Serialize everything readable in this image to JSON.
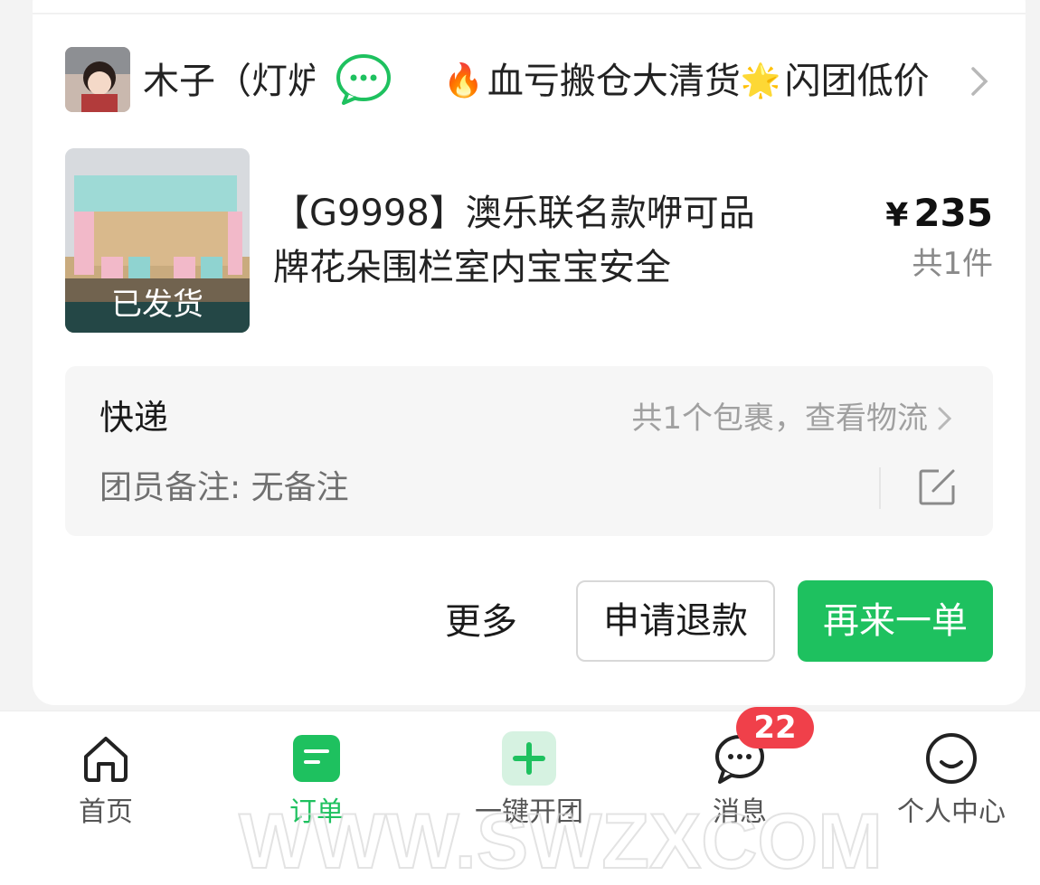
{
  "order": {
    "leader_name": "木子（灯炉",
    "group_title": "血亏搬仓大清货",
    "group_title_suffix": "闪团低价",
    "group_title_emoji_left": "🔥",
    "group_title_emoji_mid": "🌟",
    "product_title": "【G9998】澳乐联名款咿可品牌花朵围栏室内宝宝安全",
    "status": "已发货",
    "currency": "¥",
    "price": "235",
    "quantity_text": "共1件"
  },
  "shipping": {
    "method": "快递",
    "tracking_text": "共1个包裹，查看物流",
    "remark_label": "团员备注: ",
    "remark_value": "无备注"
  },
  "actions": {
    "more": "更多",
    "refund": "申请退款",
    "reorder": "再来一单"
  },
  "tabbar": {
    "items": [
      {
        "label": "首页",
        "icon": "home-icon"
      },
      {
        "label": "订单",
        "icon": "order-icon",
        "active": true
      },
      {
        "label": "一键开团",
        "icon": "plus-icon"
      },
      {
        "label": "消息",
        "icon": "message-icon"
      },
      {
        "label": "个人中心",
        "icon": "smile-icon"
      }
    ],
    "message_badge": "22"
  },
  "watermark": {
    "text": "WWW.SWZXCOM"
  },
  "colors": {
    "accent": "#1ec15f",
    "badge": "#f0404a",
    "muted": "#a0a0a0"
  }
}
